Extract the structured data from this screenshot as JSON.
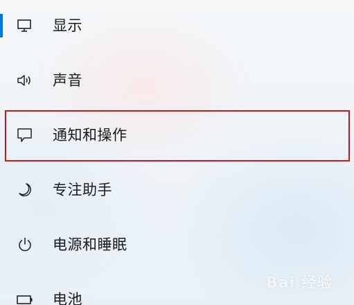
{
  "nav": {
    "items": [
      {
        "label": "显示",
        "icon": "display-icon",
        "selected": true
      },
      {
        "label": "声音",
        "icon": "speaker-icon",
        "selected": false
      },
      {
        "label": "通知和操作",
        "icon": "notification-icon",
        "selected": false,
        "highlighted": true
      },
      {
        "label": "专注助手",
        "icon": "moon-icon",
        "selected": false
      },
      {
        "label": "电源和睡眠",
        "icon": "power-icon",
        "selected": false
      },
      {
        "label": "电池",
        "icon": "battery-icon",
        "selected": false
      }
    ]
  },
  "colors": {
    "accent": "#0078d7",
    "highlight_border": "#c9151b"
  },
  "watermark": "Bai 经验"
}
